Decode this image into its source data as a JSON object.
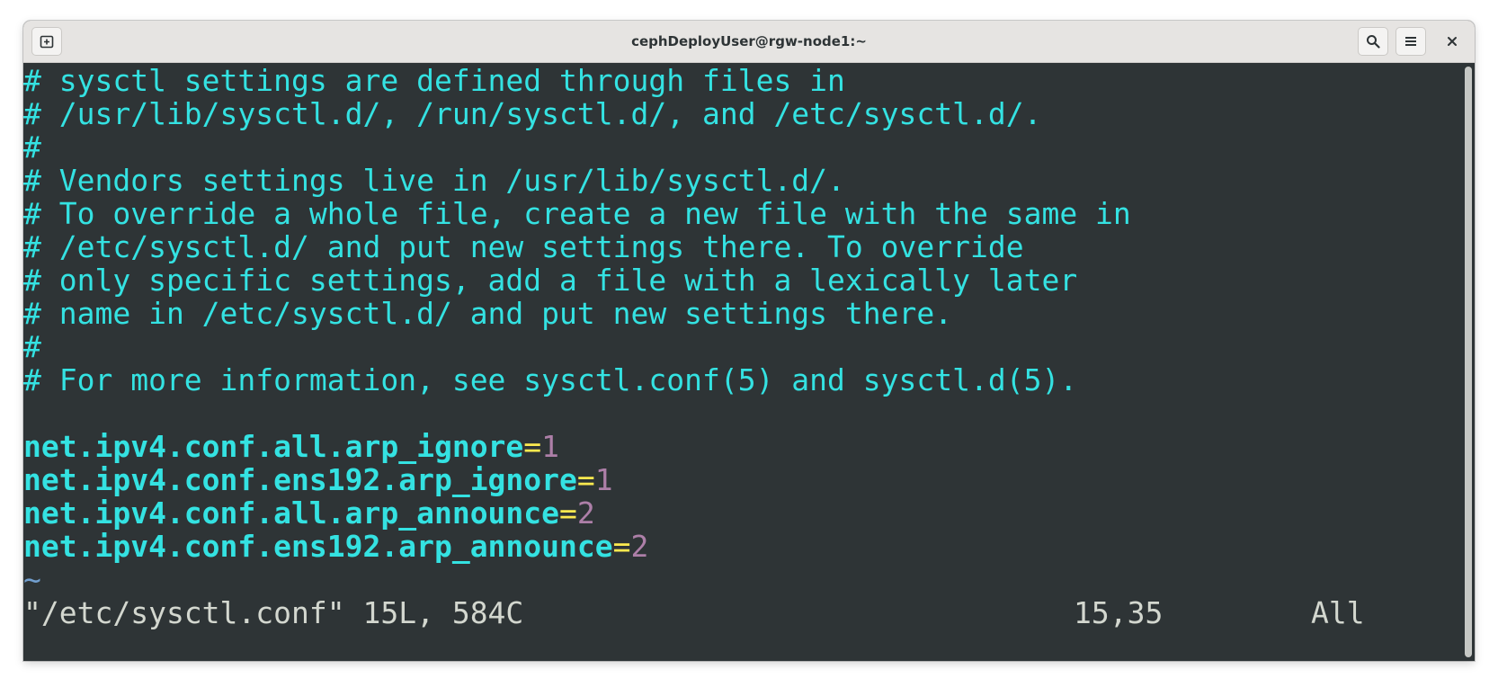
{
  "window": {
    "title": "cephDeployUser@rgw-node1:~"
  },
  "icons": {
    "new_tab": "new-tab-icon",
    "search": "search-icon",
    "menu": "hamburger-menu-icon",
    "close": "close-icon"
  },
  "colors": {
    "terminal_bg": "#2e3436",
    "text_cyan": "#34e2e2",
    "equals_yellow": "#fce94f",
    "number_purple": "#ad7fa8",
    "tilde_blue": "#729fcf",
    "status_text": "#d3d7cf"
  },
  "editor": {
    "comments": [
      "# sysctl settings are defined through files in",
      "# /usr/lib/sysctl.d/, /run/sysctl.d/, and /etc/sysctl.d/.",
      "#",
      "# Vendors settings live in /usr/lib/sysctl.d/.",
      "# To override a whole file, create a new file with the same in",
      "# /etc/sysctl.d/ and put new settings there. To override",
      "# only specific settings, add a file with a lexically later",
      "# name in /etc/sysctl.d/ and put new settings there.",
      "#",
      "# For more information, see sysctl.conf(5) and sysctl.d(5)."
    ],
    "settings": [
      {
        "key": "net.ipv4.conf.all.arp_ignore",
        "eq": "=",
        "value": "1"
      },
      {
        "key": "net.ipv4.conf.ens192.arp_ignore",
        "eq": "=",
        "value": "1"
      },
      {
        "key": "net.ipv4.conf.all.arp_announce",
        "eq": "=",
        "value": "2"
      },
      {
        "key": "net.ipv4.conf.ens192.arp_announce",
        "eq": "=",
        "value": "2"
      }
    ],
    "tilde": "~"
  },
  "status": {
    "file_info": "\"/etc/sysctl.conf\" 15L, 584C",
    "cursor_pos": "15,35",
    "scroll_pos": "All"
  }
}
